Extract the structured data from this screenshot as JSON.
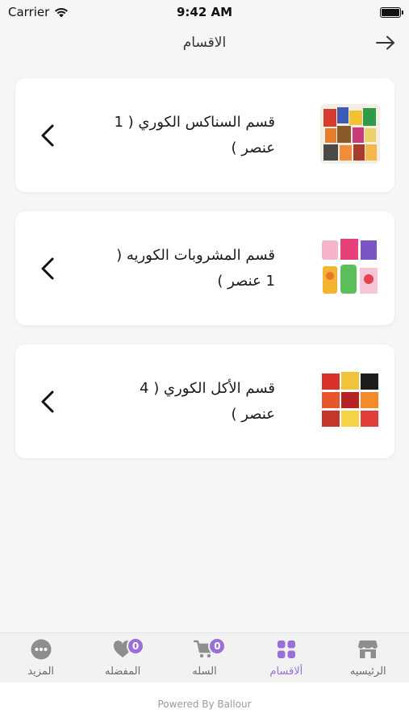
{
  "status_bar": {
    "carrier": "Carrier",
    "time": "9:42 AM"
  },
  "header": {
    "title": "الاقسام",
    "back_icon": "arrow-right-icon"
  },
  "categories": [
    {
      "line1": "قسم السناكس الكوري ( 1",
      "line2": "عنصر )",
      "thumb": "korean-snacks-image"
    },
    {
      "line1": "قسم المشروبات الكوريه (",
      "line2": "1 عنصر )",
      "thumb": "korean-drinks-image"
    },
    {
      "line1": "قسم الأكل الكوري ( 4",
      "line2": "عنصر )",
      "thumb": "korean-food-image"
    }
  ],
  "tab_bar": {
    "items": [
      {
        "label": "المزيد",
        "icon": "more-icon",
        "active": false
      },
      {
        "label": "المفضله",
        "icon": "heart-icon",
        "badge": "0",
        "active": false
      },
      {
        "label": "السله",
        "icon": "cart-icon",
        "badge": "0",
        "active": false
      },
      {
        "label": "ألاقسام",
        "icon": "grid-icon",
        "active": true
      },
      {
        "label": "الرئيسيه",
        "icon": "store-icon",
        "active": false
      }
    ],
    "accent_color": "#9b6fd8",
    "inactive_icon_color": "#8e8e8e"
  },
  "footer": {
    "text": "Powered By Ballour"
  }
}
